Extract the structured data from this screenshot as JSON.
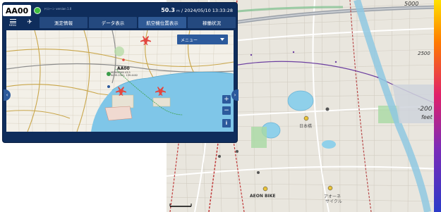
{
  "device": {
    "id_badge": "AA00",
    "version": "ドローン version 1.0",
    "altitude_value": "50.3",
    "altitude_unit": "m",
    "timestamp": "2024/05/10 13:33:28"
  },
  "toolbar": {
    "menu_label": "MENU",
    "tabs": [
      {
        "label": "測定情報"
      },
      {
        "label": "データ表示"
      },
      {
        "label": "航空機位置表示"
      },
      {
        "label": "稼働状況"
      }
    ]
  },
  "map": {
    "menu_dropdown": "メニュー",
    "aircraft_label": "AA00",
    "aircraft_sub_1": "MOUNTAIN 43.5",
    "aircraft_sub_2": "IN 35.2301, 139.4402",
    "zoom_in": "+",
    "zoom_out": "−",
    "info": "i"
  },
  "large_map": {
    "altitude_labels": [
      "5000",
      "2500",
      "-200",
      "feet"
    ],
    "place_labels": [
      "日本橋",
      "AEON BIKE",
      "アオーネ",
      "サイクル"
    ]
  },
  "colors": {
    "device_frame": "#0f2d5c",
    "tab_bg": "#24497f",
    "accent_blue": "#2c5a9c",
    "status_green": "#3fbf3f",
    "water": "#7fc6e8",
    "aircraft_red": "#e2463f"
  }
}
